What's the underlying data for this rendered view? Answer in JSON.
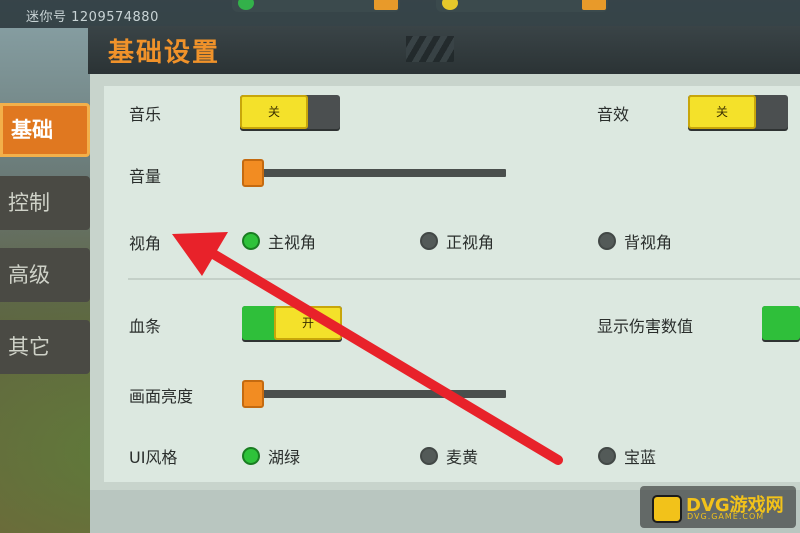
{
  "topbar": {
    "uid_text": "迷你号 1209574880"
  },
  "header": {
    "title": "基础设置"
  },
  "sidebar": {
    "items": [
      {
        "label": "基础",
        "active": true
      },
      {
        "label": "控制",
        "active": false
      },
      {
        "label": "高级",
        "active": false
      },
      {
        "label": "其它",
        "active": false
      }
    ]
  },
  "settings": {
    "music": {
      "label": "音乐",
      "toggle_text": "关",
      "on": false
    },
    "sound_effects": {
      "label": "音效",
      "toggle_text": "关",
      "on": false
    },
    "volume": {
      "label": "音量",
      "level": 0.0
    },
    "view_angle": {
      "label": "视角",
      "options": [
        {
          "label": "主视角",
          "selected": true
        },
        {
          "label": "正视角",
          "selected": false
        },
        {
          "label": "背视角",
          "selected": false
        }
      ]
    },
    "health_bar": {
      "label": "血条",
      "toggle_text": "开",
      "on": true
    },
    "damage_numbers": {
      "label": "显示伤害数值",
      "on": true
    },
    "brightness": {
      "label": "画面亮度",
      "level": 0.0
    },
    "ui_style": {
      "label": "UI风格",
      "options": [
        {
          "label": "湖绿",
          "selected": true
        },
        {
          "label": "麦黄",
          "selected": false
        },
        {
          "label": "宝蓝",
          "selected": false
        }
      ]
    }
  },
  "watermark": {
    "text": "DVG游戏网",
    "sub": "DVG.GAME.COM"
  },
  "colors": {
    "accent": "#f0922a",
    "selected": "#2ec23a",
    "toggle_knob": "#f4e12a",
    "arrow": "#e8222a"
  }
}
